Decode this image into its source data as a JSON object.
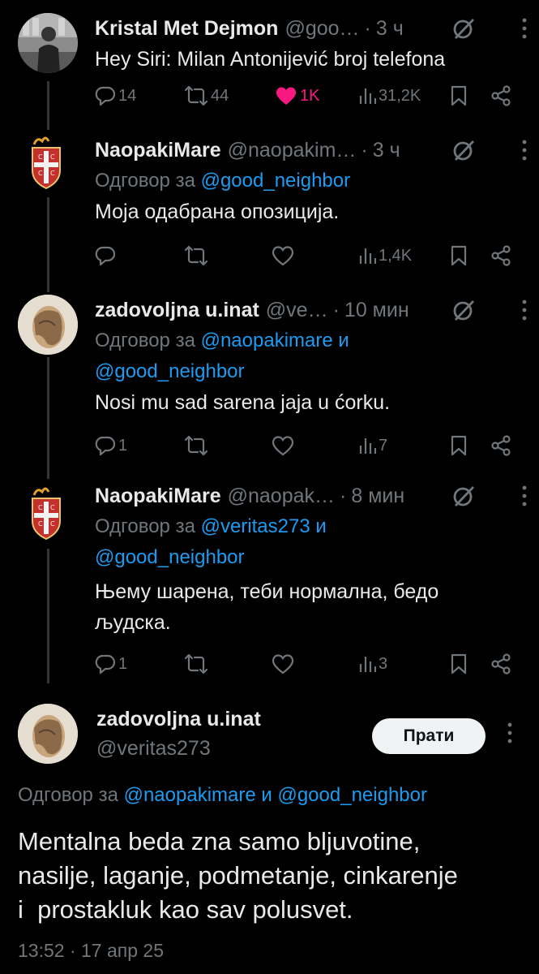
{
  "tweets": [
    {
      "name": "Kristal Met Dejmon",
      "handle": "@goo…",
      "time": "3 ч",
      "text": "Hey Siri: Milan Antonijević broj telefona",
      "replies": "14",
      "retweets": "44",
      "likes": "1K",
      "views": "31,2K"
    },
    {
      "name": "NaopakiMare",
      "handle": "@naopakim…",
      "time": "3 ч",
      "replying_prefix": "Одговор за",
      "replying_to": "@good_neighbor",
      "text": "Моја одабрана опозиција.",
      "views": "1,4K"
    },
    {
      "name": "zadovoljna u.inat",
      "handle": "@ve…",
      "time": "10 мин",
      "replying_prefix": "Одговор за",
      "replying_to_1": "@naopakimare",
      "replying_and": "и",
      "replying_to_2": "@good_neighbor",
      "text": "Nosi mu sad sarena jaja u ćorku.",
      "replies": "1",
      "views": "7"
    },
    {
      "name": "NaopakiMare",
      "handle": "@naopak…",
      "time": "8 мин",
      "replying_prefix": "Одговор за",
      "replying_to_1": "@veritas273",
      "replying_and": "и",
      "replying_to_2": "@good_neighbor",
      "text_line1": "Њему шарена, теби нормална, бедо",
      "text_line2": "људска.",
      "replies": "1",
      "views": "3"
    }
  ],
  "main": {
    "name": "zadovoljna u.inat",
    "handle": "@veritas273",
    "follow_label": "Прати",
    "replying_prefix": "Одговор за",
    "replying_to_1": "@naopakimare",
    "replying_and": "и",
    "replying_to_2": "@good_neighbor",
    "text_line1": "Mentalna beda zna samo bljuvotine,",
    "text_line2": "nasilje, laganje, podmetanje, cinkarenje",
    "text_line3": "i  prostakluk kao sav polusvet.",
    "timestamp": "13:52 · 17 апр 25"
  },
  "colors": {
    "background": "#000000",
    "text": "#e7e9ea",
    "secondary": "#71767b",
    "link": "#1d9bf0",
    "like": "#f91880"
  },
  "icons": [
    "reply-icon",
    "retweet-icon",
    "like-icon",
    "views-icon",
    "bookmark-icon",
    "share-icon",
    "grok-icon",
    "more-icon"
  ]
}
